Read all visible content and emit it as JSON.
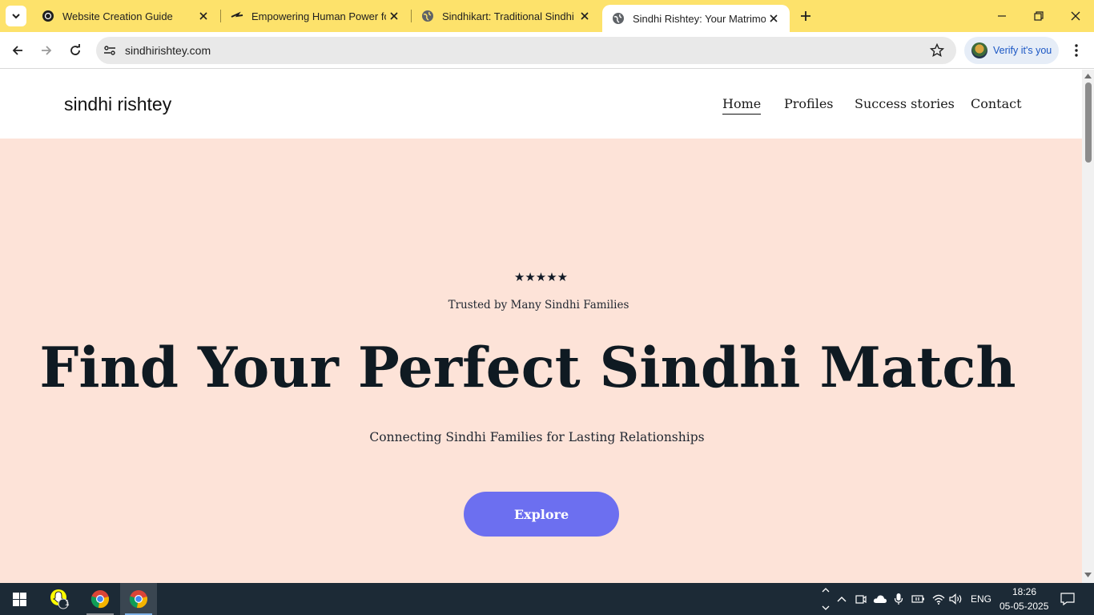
{
  "browser": {
    "tabs": [
      {
        "title": "Website Creation Guide",
        "icon": "openai-icon"
      },
      {
        "title": "Empowering Human Power for",
        "icon": "arrow-logo-icon"
      },
      {
        "title": "Sindhikart: Traditional Sindhi Pr",
        "icon": "globe-icon"
      },
      {
        "title": "Sindhi Rishtey: Your Matrimonia",
        "icon": "globe-icon",
        "active": true
      }
    ],
    "url": "sindhirishtey.com",
    "verify_label": "Verify it's you"
  },
  "site": {
    "brand": "sindhi rishtey",
    "nav": [
      "Home",
      "Profiles",
      "Success stories",
      "Contact"
    ],
    "hero": {
      "stars": "★★★★★",
      "trusted": "Trusted by Many Sindhi Families",
      "headline": "Find Your Perfect Sindhi Match",
      "subline": "Connecting Sindhi Families for Lasting Relationships",
      "cta": "Explore"
    }
  },
  "taskbar": {
    "language": "ENG",
    "time": "18:26",
    "date": "05-05-2025",
    "notification_badge": "1"
  },
  "colors": {
    "tabstrip": "#fde26b",
    "hero_bg": "#fde3d8",
    "cta_bg": "#6c6ff0",
    "taskbar": "#1c2a36"
  }
}
